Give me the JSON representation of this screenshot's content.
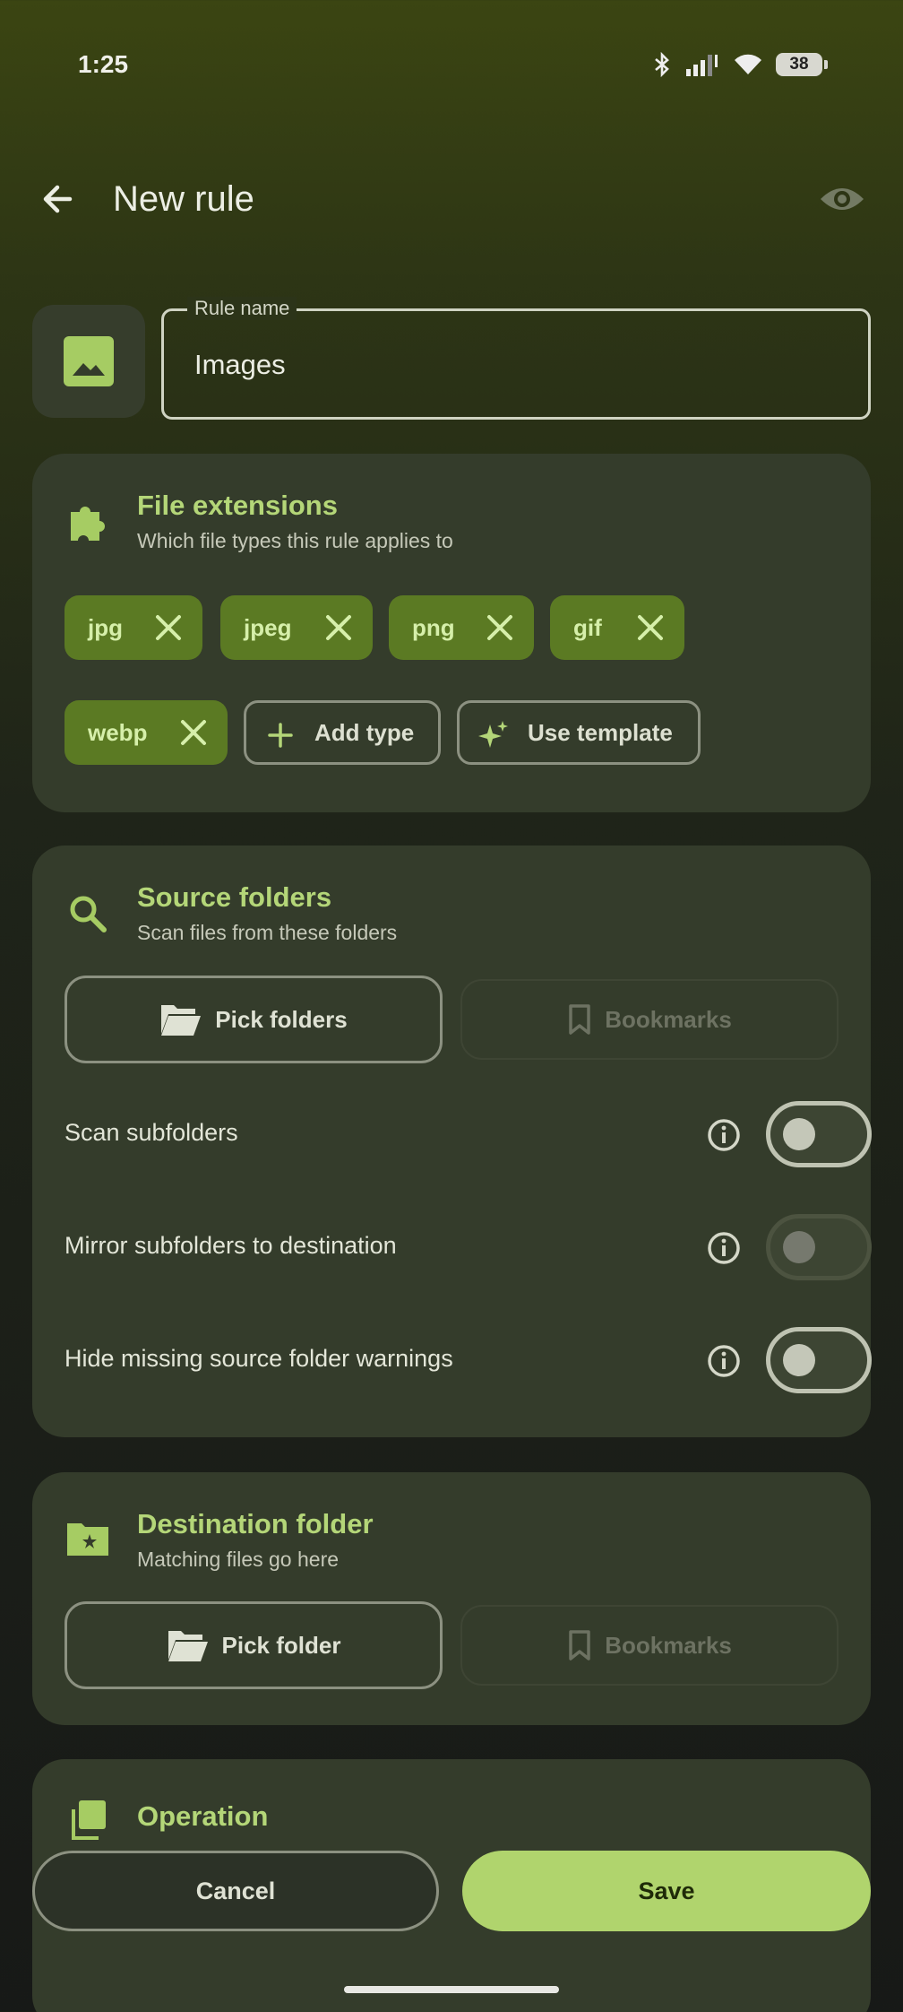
{
  "status": {
    "time": "1:25",
    "battery": "38"
  },
  "header": {
    "title": "New rule"
  },
  "rule_name": {
    "label": "Rule name",
    "value": "Images"
  },
  "file_extensions": {
    "title": "File extensions",
    "subtitle": "Which file types this rule applies to",
    "chips": [
      "jpg",
      "jpeg",
      "png",
      "gif",
      "webp"
    ],
    "add_type_label": "Add type",
    "use_template_label": "Use template"
  },
  "source_folders": {
    "title": "Source folders",
    "subtitle": "Scan files from these folders",
    "pick_label": "Pick folders",
    "bookmarks_label": "Bookmarks",
    "settings": [
      {
        "label": "Scan subfolders",
        "enabled": false
      },
      {
        "label": "Mirror subfolders to destination",
        "enabled": false
      },
      {
        "label": "Hide missing source folder warnings",
        "enabled": false
      }
    ]
  },
  "destination_folder": {
    "title": "Destination folder",
    "subtitle": "Matching files go here",
    "pick_label": "Pick folder",
    "bookmarks_label": "Bookmarks"
  },
  "operation": {
    "title": "Operation"
  },
  "actions": {
    "cancel_label": "Cancel",
    "save_label": "Save"
  },
  "colors": {
    "accent": "#b0d46d",
    "chip_bg": "#5b7a23",
    "card_bg": "#343c2b"
  }
}
